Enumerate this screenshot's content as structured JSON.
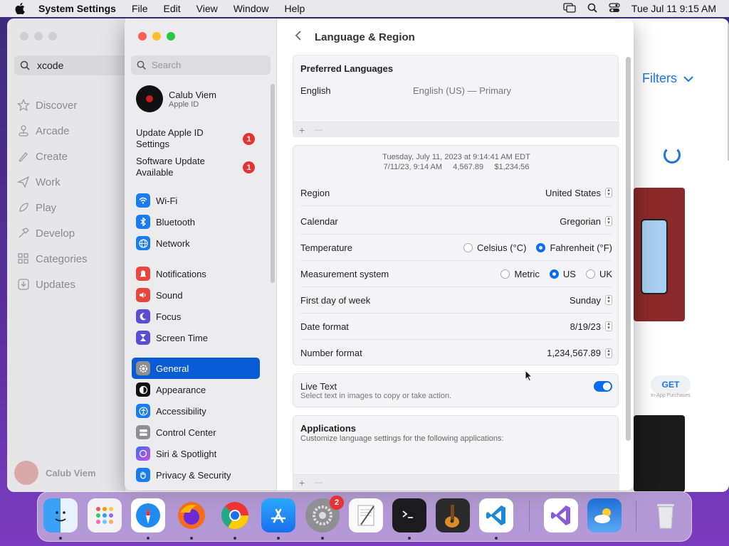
{
  "menubar": {
    "app_name": "System Settings",
    "items": [
      "File",
      "Edit",
      "View",
      "Window",
      "Help"
    ],
    "clock": "Tue Jul 11  9:15 AM"
  },
  "appstore": {
    "search_value": "xcode",
    "nav": [
      "Discover",
      "Arcade",
      "Create",
      "Work",
      "Play",
      "Develop",
      "Categories",
      "Updates"
    ],
    "user_name": "Calub Viem",
    "filters_label": "Filters",
    "get_label": "GET",
    "in_app_label": "In-App Purchases"
  },
  "settings": {
    "search_placeholder": "Search",
    "profile": {
      "name": "Calub Viem",
      "subtitle": "Apple ID"
    },
    "alerts": [
      {
        "label": "Update Apple ID Settings",
        "count": "1"
      },
      {
        "label": "Software Update Available",
        "count": "1"
      }
    ],
    "nav_group1": [
      {
        "label": "Wi-Fi",
        "icon": "wifi-icon",
        "color": "#1a7cf0"
      },
      {
        "label": "Bluetooth",
        "icon": "bluetooth-icon",
        "color": "#1a7cf0"
      },
      {
        "label": "Network",
        "icon": "globe-icon",
        "color": "#1a7cf0"
      }
    ],
    "nav_group2": [
      {
        "label": "Notifications",
        "icon": "bell-icon",
        "color": "#e8453c"
      },
      {
        "label": "Sound",
        "icon": "speaker-icon",
        "color": "#e8453c"
      },
      {
        "label": "Focus",
        "icon": "moon-icon",
        "color": "#5a4ed6"
      },
      {
        "label": "Screen Time",
        "icon": "hourglass-icon",
        "color": "#5a4ed6"
      }
    ],
    "nav_group3": [
      {
        "label": "General",
        "icon": "gear-icon",
        "color": "#8e8e93",
        "active": true
      },
      {
        "label": "Appearance",
        "icon": "appearance-icon",
        "color": "#111111"
      },
      {
        "label": "Accessibility",
        "icon": "accessibility-icon",
        "color": "#1a7cf0"
      },
      {
        "label": "Control Center",
        "icon": "control-center-icon",
        "color": "#8e8e93"
      },
      {
        "label": "Siri & Spotlight",
        "icon": "siri-icon",
        "color": "#b04ee8"
      },
      {
        "label": "Privacy & Security",
        "icon": "hand-icon",
        "color": "#1a7cf0"
      }
    ]
  },
  "content": {
    "title": "Language & Region",
    "preferred": {
      "header": "Preferred Languages",
      "lang": "English",
      "lang_detail": "English (US) — Primary",
      "plus": "+",
      "minus": "—"
    },
    "format_preview": {
      "line1": "Tuesday, July 11, 2023 at 9:14:41 AM EDT",
      "line2": "7/11/23, 9:14 AM     4,567.89     $1,234.56"
    },
    "rows": {
      "region": {
        "label": "Region",
        "value": "United States"
      },
      "calendar": {
        "label": "Calendar",
        "value": "Gregorian"
      },
      "temperature": {
        "label": "Temperature",
        "options": [
          "Celsius (°C)",
          "Fahrenheit (°F)"
        ],
        "selected": "Fahrenheit (°F)"
      },
      "measurement": {
        "label": "Measurement system",
        "options": [
          "Metric",
          "US",
          "UK"
        ],
        "selected": "US"
      },
      "first_day": {
        "label": "First day of week",
        "value": "Sunday"
      },
      "date_format": {
        "label": "Date format",
        "value": "8/19/23"
      },
      "number_format": {
        "label": "Number format",
        "value": "1,234,567.89"
      }
    },
    "live_text": {
      "label": "Live Text",
      "desc": "Select text in images to copy or take action.",
      "on": true
    },
    "applications": {
      "header": "Applications",
      "desc": "Customize language settings for the following applications:",
      "plus": "+",
      "minus": "—"
    }
  },
  "dock": {
    "apps": [
      "Finder",
      "Launchpad",
      "Safari",
      "Firefox",
      "Chrome",
      "App Store",
      "System Settings",
      "TextEdit",
      "Terminal",
      "GarageBand",
      "VS Code",
      "Visual Studio",
      "Weather",
      "Trash"
    ],
    "settings_badge": "2"
  }
}
